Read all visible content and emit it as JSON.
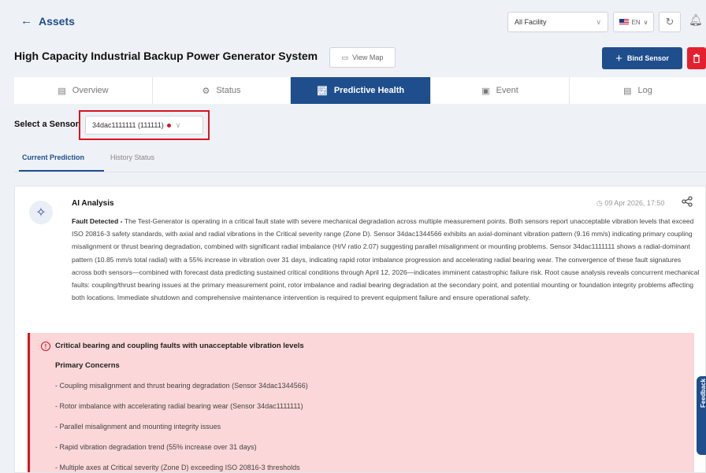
{
  "header": {
    "back_label": "Assets",
    "facility_select": "All Facility",
    "language": "EN"
  },
  "asset": {
    "title": "High Capacity Industrial Backup Power Generator System",
    "view_map_label": "View Map",
    "bind_sensor_label": "Bind Sensor"
  },
  "tabs": [
    {
      "label": "Overview",
      "icon": "document-icon"
    },
    {
      "label": "Status",
      "icon": "gear-icon"
    },
    {
      "label": "Predictive Health",
      "icon": "chart-icon",
      "active": true
    },
    {
      "label": "Event",
      "icon": "calendar-icon"
    },
    {
      "label": "Log",
      "icon": "log-icon"
    }
  ],
  "sensor": {
    "label": "Select a Sensor",
    "value": "34dac1111111 (111111)",
    "status_color": "#d9141f"
  },
  "subtabs": [
    {
      "label": "Current Prediction",
      "active": true
    },
    {
      "label": "History Status"
    }
  ],
  "analysis": {
    "title": "AI Analysis",
    "timestamp": "09 Apr 2026, 17:50",
    "lead": "Fault Detected - ",
    "body": "The Test-Generator is operating in a critical fault state with severe mechanical degradation across multiple measurement points. Both sensors report unacceptable vibration levels that exceed ISO 20816-3 safety standards, with axial and radial vibrations in the Critical severity range (Zone D). Sensor 34dac1344566 exhibits an axial-dominant vibration pattern (9.16 mm/s) indicating primary coupling misalignment or thrust bearing degradation, combined with significant radial imbalance (H/V ratio 2.07) suggesting parallel misalignment or mounting problems. Sensor 34dac1111111 shows a radial-dominant pattern (10.85 mm/s total radial) with a 55% increase in vibration over 31 days, indicating rapid rotor imbalance progression and accelerating radial bearing wear. The convergence of these fault signatures across both sensors—combined with forecast data predicting sustained critical conditions through April 12, 2026—indicates imminent catastrophic failure risk. Root cause analysis reveals concurrent mechanical faults: coupling/thrust bearing issues at the primary measurement point, rotor imbalance and radial bearing degradation at the secondary point, and potential mounting or foundation integrity problems affecting both locations. Immediate shutdown and comprehensive maintenance intervention is required to prevent equipment failure and ensure operational safety."
  },
  "alert": {
    "title": "Critical bearing and coupling faults with unacceptable vibration levels",
    "concerns_heading": "Primary Concerns",
    "concerns": [
      "- Coupling misalignment and thrust bearing degradation (Sensor 34dac1344566)",
      "- Rotor imbalance with accelerating radial bearing wear (Sensor 34dac1111111)",
      "- Parallel misalignment and mounting integrity issues",
      "- Rapid vibration degradation trend (55% increase over 31 days)",
      "- Multiple axes at Critical severity (Zone D) exceeding ISO 20816-3 thresholds"
    ],
    "color": "#d9141f"
  },
  "feedback_label": "Feedback",
  "colors": {
    "primary": "#1f4e8c",
    "danger": "#e5202e",
    "alert_bg": "#fbd7d9"
  }
}
